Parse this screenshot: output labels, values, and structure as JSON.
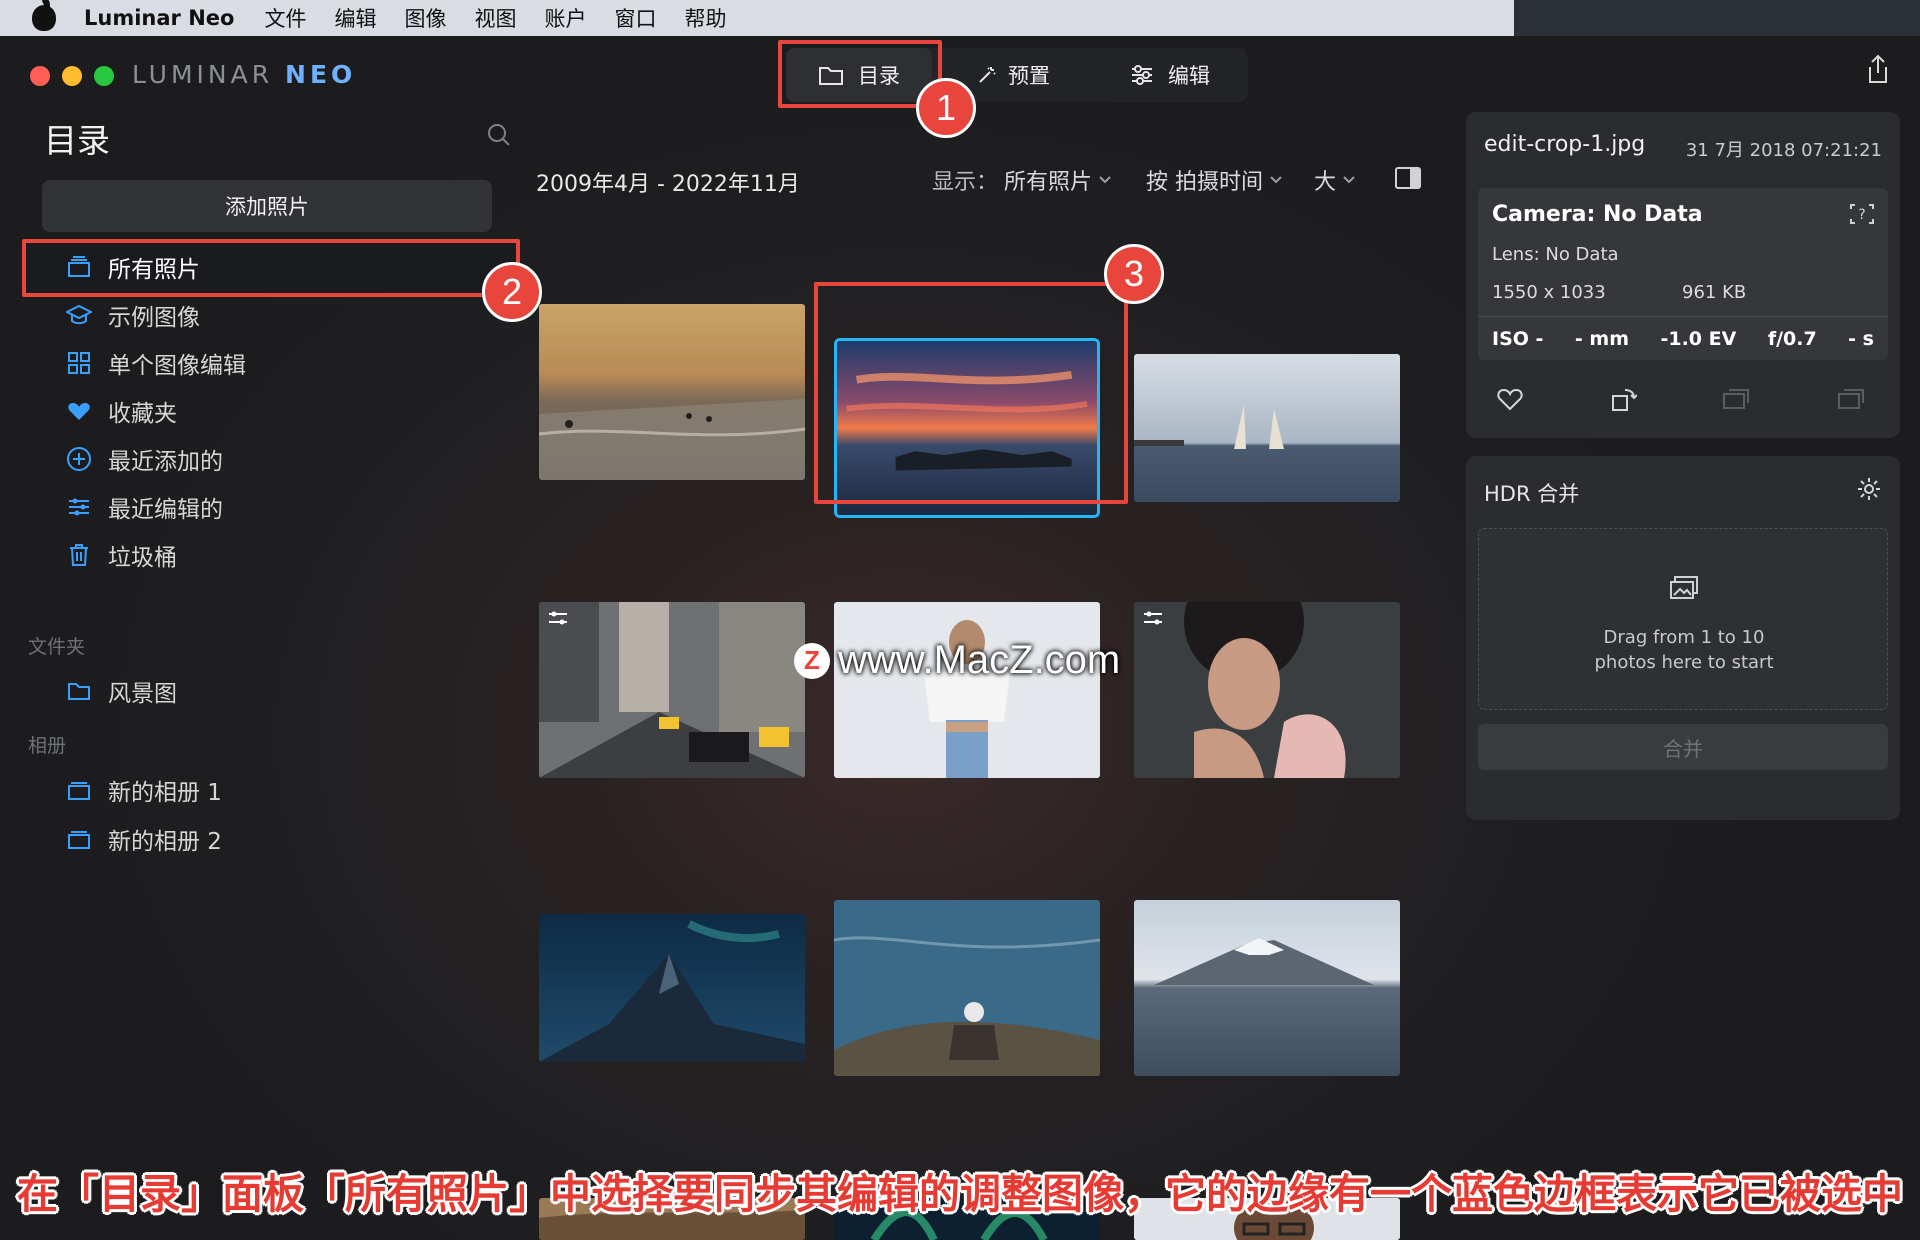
{
  "menubar": {
    "app_name": "Luminar Neo",
    "items": [
      "文件",
      "编辑",
      "图像",
      "视图",
      "账户",
      "窗口",
      "帮助"
    ]
  },
  "window": {
    "logo_main": "LUMINAR ",
    "logo_accent": "NEO",
    "tabs": {
      "catalog": "目录",
      "presets": "预置",
      "edit": "编辑"
    }
  },
  "sidebar": {
    "title": "目录",
    "add_button": "添加照片",
    "items": [
      {
        "label": "所有照片",
        "icon": "stack-icon"
      },
      {
        "label": "示例图像",
        "icon": "graduation-cap-icon"
      },
      {
        "label": "单个图像编辑",
        "icon": "grid-icon"
      },
      {
        "label": "收藏夹",
        "icon": "heart-icon"
      },
      {
        "label": "最近添加的",
        "icon": "plus-circle-icon"
      },
      {
        "label": "最近编辑的",
        "icon": "sliders-icon"
      },
      {
        "label": "垃圾桶",
        "icon": "trash-icon"
      }
    ],
    "folders_label": "文件夹",
    "folders": [
      {
        "label": "风景图",
        "icon": "folder-icon"
      }
    ],
    "albums_label": "相册",
    "albums": [
      {
        "label": "新的相册 1",
        "icon": "album-icon"
      },
      {
        "label": "新的相册 2",
        "icon": "album-icon"
      }
    ]
  },
  "main": {
    "date_range": "2009年4月 - 2022年11月",
    "show_label": "显示：",
    "show_value": "所有照片",
    "sort_value": "按 拍摄时间",
    "size_value": "大"
  },
  "info": {
    "filename": "edit-crop-1.jpg",
    "date": "31 7月 2018 07:21:21",
    "camera": "Camera: No Data",
    "lens": "Lens: No Data",
    "dimensions": "1550 x 1033",
    "filesize": "961 KB",
    "iso": "ISO -",
    "focal": "- mm",
    "ev": "-1.0 EV",
    "aperture": "f/0.7",
    "shutter": "- s"
  },
  "hdr": {
    "title": "HDR 合并",
    "drop_line1": "Drag from 1 to 10",
    "drop_line2": "photos here to start",
    "merge_button": "合并"
  },
  "annotations": {
    "callout_1": "1",
    "callout_2": "2",
    "callout_3": "3",
    "watermark": "www.MacZ.com",
    "watermark_logo": "Z",
    "caption": "在「目录」面板「所有照片」中选择要同步其编辑的调整图像，它的边缘有一个蓝色边框表示它已被选中"
  },
  "colors": {
    "accent_blue": "#3aa0ff",
    "selection_border": "#27b6f5",
    "callout_red": "#e8453c"
  }
}
